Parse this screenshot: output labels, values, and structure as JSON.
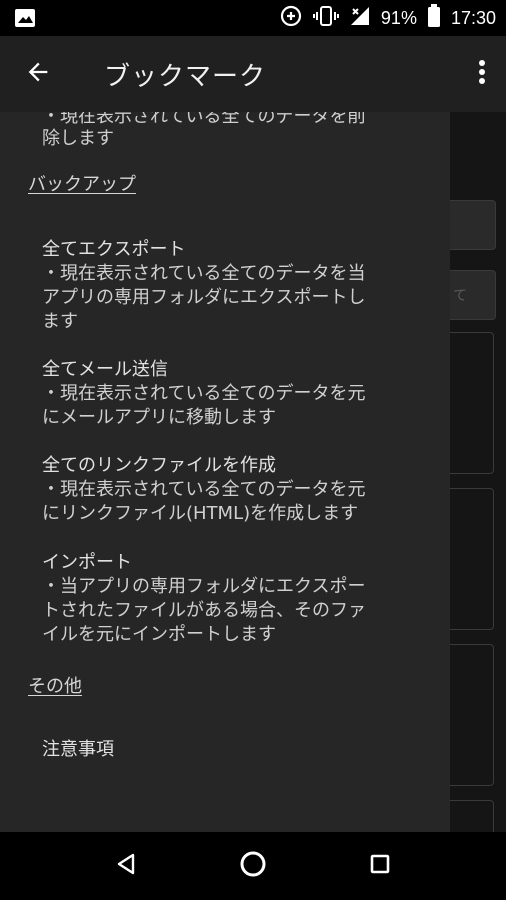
{
  "status_bar": {
    "battery": "91%",
    "time": "17:30",
    "icons": [
      "image-icon",
      "data-saver-icon",
      "vibrate-icon",
      "signal-icon",
      "battery-icon"
    ]
  },
  "app_bar": {
    "title": "ブックマーク",
    "back_icon": "arrow-back-icon",
    "more_icon": "more-vert-icon"
  },
  "drawer": {
    "clipped_top_text": "・現在表示されている全てのデータを削",
    "clipped_continuation": "除します",
    "sections": [
      {
        "heading": "バックアップ",
        "items": [
          {
            "title": "全てエクスポート",
            "description": "・現在表示されている全てのデータを当\nアプリの専用フォルダにエクスポートし\nます"
          },
          {
            "title": "全てメール送信",
            "description": "・現在表示されている全てのデータを元\nにメールアプリに移動します"
          },
          {
            "title": "全てのリンクファイルを作成",
            "description": "・現在表示されている全てのデータを元\nにリンクファイル(HTML)を作成します"
          },
          {
            "title": "インポート",
            "description": "・当アプリの専用フォルダにエクスポー\nトされたファイルがある場合、そのファ\nイルを元にインポートします"
          }
        ]
      },
      {
        "heading": "その他",
        "items": [
          {
            "title": "注意事項"
          }
        ]
      }
    ]
  },
  "background": {
    "partial_texts": [
      "て"
    ]
  },
  "nav_bar": {
    "icons": [
      "back-triangle-icon",
      "home-circle-icon",
      "recents-square-icon"
    ]
  }
}
